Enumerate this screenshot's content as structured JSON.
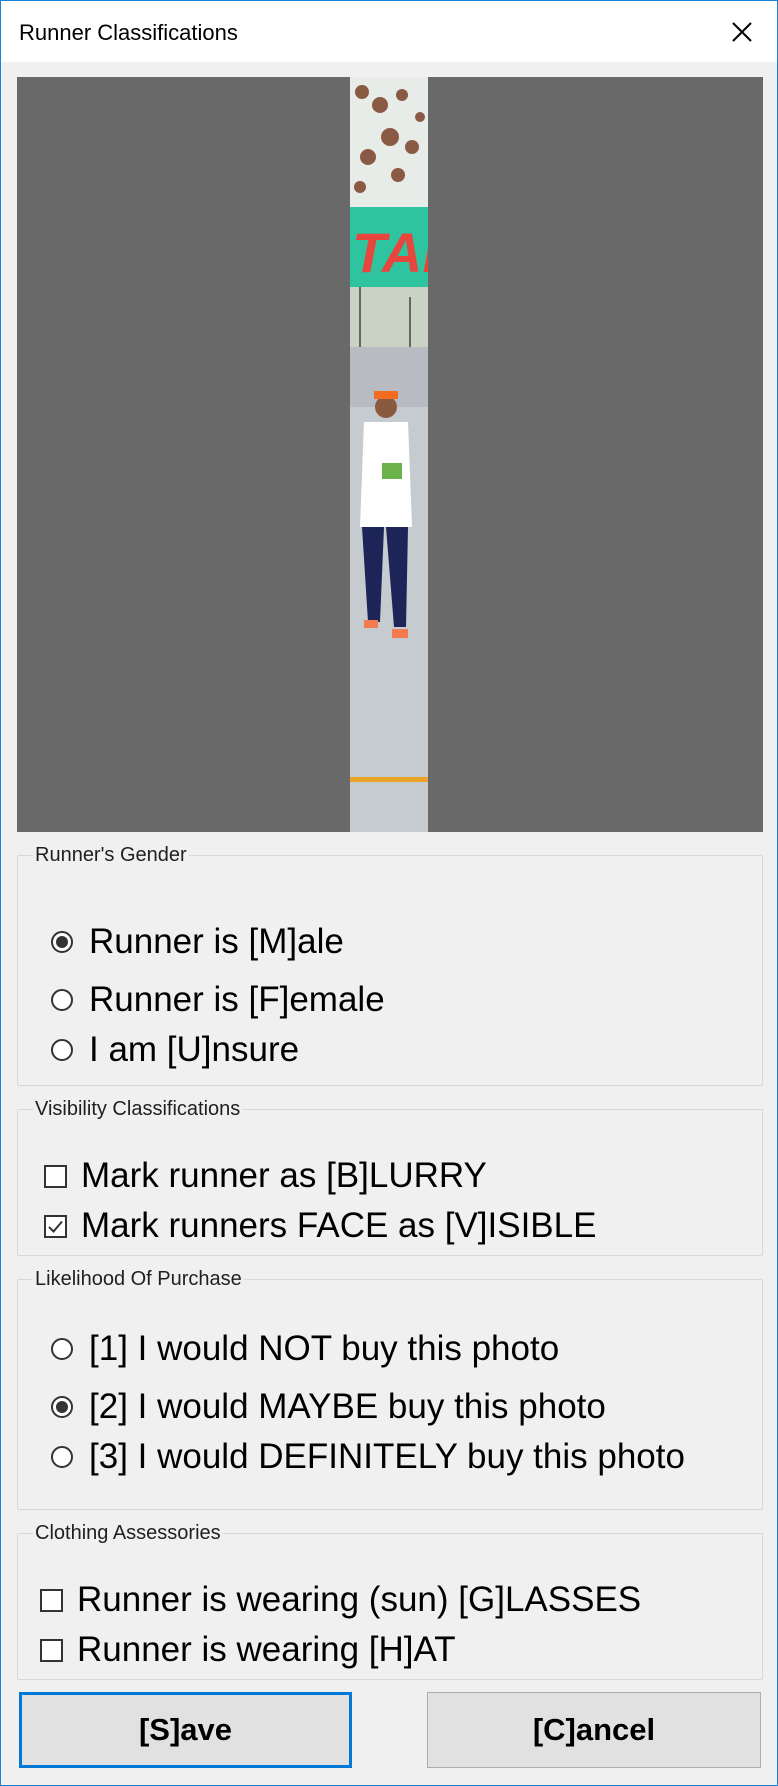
{
  "window": {
    "title": "Runner Classifications"
  },
  "gender": {
    "title": "Runner's Gender",
    "options": [
      {
        "label": "Runner is [M]ale",
        "checked": true
      },
      {
        "label": "Runner is [F]emale",
        "checked": false
      },
      {
        "label": "I am [U]nsure",
        "checked": false
      }
    ]
  },
  "visibility": {
    "title": "Visibility Classifications",
    "options": [
      {
        "label": "Mark runner as [B]LURRY",
        "checked": false
      },
      {
        "label": "Mark runners FACE as [V]ISIBLE",
        "checked": true
      }
    ]
  },
  "purchase": {
    "title": "Likelihood Of Purchase",
    "options": [
      {
        "label": "[1] I would NOT buy this photo",
        "checked": false
      },
      {
        "label": "[2] I would MAYBE buy this photo",
        "checked": true
      },
      {
        "label": "[3] I would DEFINITELY buy this photo",
        "checked": false
      }
    ]
  },
  "clothing": {
    "title": "Clothing Assessories",
    "options": [
      {
        "label": "Runner is wearing (sun) [G]LASSES",
        "checked": false
      },
      {
        "label": "Runner is wearing [H]AT",
        "checked": false
      }
    ]
  },
  "buttons": {
    "save": "[S]ave",
    "cancel": "[C]ancel"
  },
  "photo_banner_text": "TAI",
  "colors": {
    "accent": "#0078d7",
    "photo_background": "#696969",
    "banner": "#2ec4a0",
    "banner_text": "#e8463c"
  }
}
